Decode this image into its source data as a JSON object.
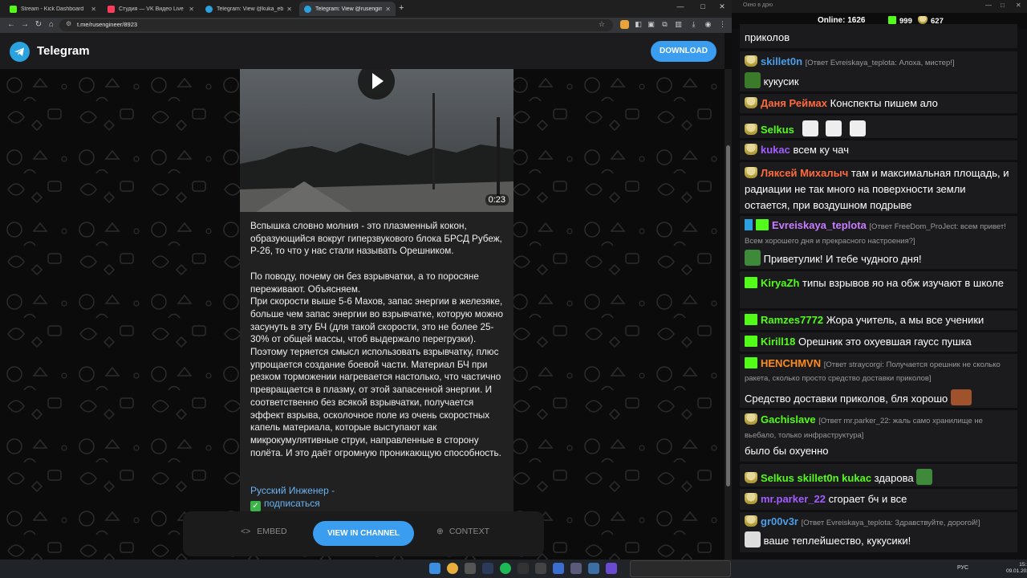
{
  "browser": {
    "tabs": [
      {
        "title": "Stream - Kick Dashboard",
        "color": "#53fc18"
      },
      {
        "title": "Студия — VK Видео Live",
        "color": "#ff3b5c"
      },
      {
        "title": "Telegram: View @kuka_ebkov",
        "color": "#2aa2e0"
      },
      {
        "title": "Telegram: View @rusengineer",
        "color": "#2aa2e0"
      }
    ],
    "url": "t.me/rusengineer/8923"
  },
  "telegram": {
    "brand": "Telegram",
    "download_label": "DOWNLOAD",
    "post": {
      "video_duration": "0:23",
      "text": "Вспышка словно молния - это плазменный кокон, образующийся вокруг гиперзвукового блока БРСД Рубеж, Р-26, то что у нас стали называть Орешником.\n\nПо поводу, почему он без взрывчатки, а то поросяне переживают. Объясняем.\nПри скорости выше 5-6 Махов, запас энергии в железяке, больше чем запас энергии во взрывчатке, которую можно засунуть в эту БЧ (для такой скорости, это не более 25-30% от общей массы, чтоб выдержало перегрузки). Поэтому теряется смысл использовать взрывчатку, плюс упрощается создание боевой части. Материал БЧ при резком торможении нагревается настолько, что частично превращается в плазму, от этой запасенной энергии. И соответственно без всякой взрывчатки, получается эффект взрыва, осколочное поле из очень скоростных капель материала, которые выступают как микрокумулятивные струи, направленные в сторону полёта. И это даёт огромную проникающую способность.",
      "author": "Русский Инженер -",
      "subscribe": "подписаться"
    },
    "actions": {
      "embed": "EMBED",
      "view_in_channel": "VIEW IN CHANNEL",
      "context": "CONTEXT"
    }
  },
  "chat": {
    "window_title": "Окно в дрю",
    "online_label": "Online:",
    "online_count": "1626",
    "kick_count": "999",
    "cup_count": "627",
    "messages": [
      {
        "user": "",
        "text": "приколов"
      },
      {
        "user": "skillet0n",
        "reply": "[Ответ Evreiskaya_teplota: Алоха, мистер!]",
        "text": "кукусик",
        "color": "#4a9ee8"
      },
      {
        "user": "Даня Реймах",
        "text": "Конспекты пишем ало",
        "color": "#ff6a3d"
      },
      {
        "user": "Selkus",
        "text": "",
        "color": "#53fc18"
      },
      {
        "user": "kukac",
        "text": "всем ку чач",
        "color": "#a35cff"
      },
      {
        "user": "Ляксей Михалыч",
        "text": "там и  максимальная площадь, и радиации не так много на поверхности земли остается, при воздушном подрыве",
        "color": "#ff6a3d"
      },
      {
        "user": "Evreiskaya_teplota",
        "reply": "[Ответ FreeDom_ProJect: всем привет! Всем хорошего дня и прекрасного настроения?]",
        "text": "Приветулик! И тебе чудного дня!",
        "color": "#c77dff"
      },
      {
        "user": "KiryaZh",
        "text": "типы взрывов яо на обж изучают в школе",
        "color": "#53fc18"
      },
      {
        "user": "Ramzes7772",
        "text": "Жора учитель, а мы все ученики",
        "color": "#53fc18"
      },
      {
        "user": "Kirill18",
        "text": "Орешник это охуевшая гаусс пушка",
        "color": "#53fc18"
      },
      {
        "user": "HENCHMVN",
        "reply": "[Ответ straycorgi: Получается орешник не сколько ракета, сколько просто средство доставки приколов]",
        "text": "Средство доставки приколов, бля хорошо",
        "color": "#ff8c1a"
      },
      {
        "user": "Gachislave",
        "reply": "[Ответ mr.parker_22: жаль само хранилище не вьебало, только инфраструктура]",
        "text": "было бы охуенно",
        "color": "#53fc18"
      },
      {
        "user": "Selkus",
        "mention": "skillet0n kukac",
        "text": "здарова",
        "color": "#53fc18"
      },
      {
        "user": "mr.parker_22",
        "text": "сгорает бч и все",
        "color": "#a35cff"
      },
      {
        "user": "gr00v3r",
        "reply": "[Ответ Evreiskaya_teplota: Здравствуйте, дорогой!]",
        "text": "ваше теплейшество, кукусики!",
        "color": "#4a9ee8"
      }
    ]
  },
  "taskbar": {
    "lang": "РУС",
    "time": "15:13",
    "date": "09.01.2026"
  }
}
